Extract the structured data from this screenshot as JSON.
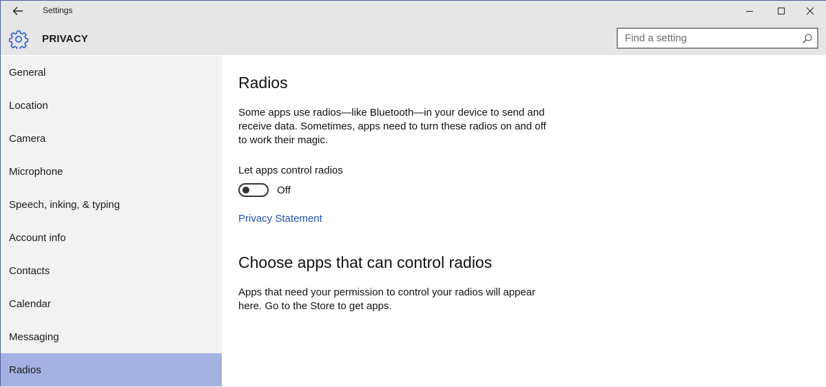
{
  "window": {
    "title": "Settings",
    "controls": {
      "minimize": "—",
      "maximize": "☐",
      "close": "✕"
    }
  },
  "header": {
    "section_title": "PRIVACY",
    "search_placeholder": "Find a setting",
    "search_value": ""
  },
  "sidebar": {
    "items": [
      {
        "label": "General",
        "selected": false
      },
      {
        "label": "Location",
        "selected": false
      },
      {
        "label": "Camera",
        "selected": false
      },
      {
        "label": "Microphone",
        "selected": false
      },
      {
        "label": "Speech, inking, & typing",
        "selected": false
      },
      {
        "label": "Account info",
        "selected": false
      },
      {
        "label": "Contacts",
        "selected": false
      },
      {
        "label": "Calendar",
        "selected": false
      },
      {
        "label": "Messaging",
        "selected": false
      },
      {
        "label": "Radios",
        "selected": true
      }
    ]
  },
  "main": {
    "heading": "Radios",
    "description": "Some apps use radios—like Bluetooth—in your device to send and receive data. Sometimes, apps need to turn these radios on and off to work their magic.",
    "toggle": {
      "label": "Let apps control radios",
      "state_text": "Off",
      "on": false
    },
    "privacy_link": "Privacy Statement",
    "apps_heading": "Choose apps that can control radios",
    "apps_description": "Apps that need your permission to control your radios will appear here. Go to the Store to get apps."
  },
  "colors": {
    "accent": "#1f4fb5",
    "selected_nav": "#a4b2e2",
    "gear": "#2b5fcf"
  }
}
